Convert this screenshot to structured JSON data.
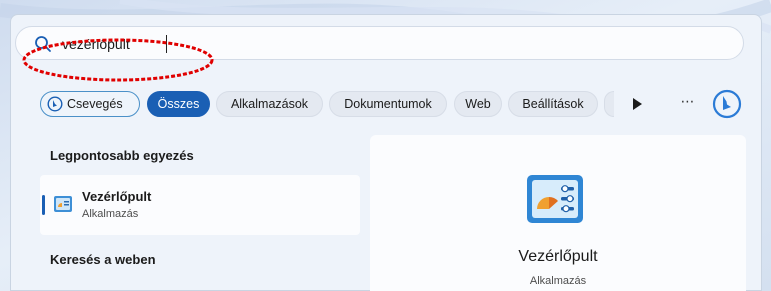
{
  "search": {
    "value": "vezérlőpult",
    "icon": "search-icon"
  },
  "filters": {
    "chat_label": "Csevegés",
    "items": [
      "Összes",
      "Alkalmazások",
      "Dokumentumok",
      "Web",
      "Beállítások"
    ],
    "active": "Összes",
    "more_icon": "play-arrow-icon",
    "overflow_icon": "ellipsis-icon",
    "bing_icon": "bing-icon"
  },
  "results": {
    "best_match_title": "Legpontosabb egyezés",
    "best_match": {
      "name": "Vezérlőpult",
      "type": "Alkalmazás",
      "icon": "control-panel-icon"
    },
    "web_title": "Keresés a weben"
  },
  "detail": {
    "name": "Vezérlőpult",
    "type": "Alkalmazás",
    "icon": "control-panel-icon"
  },
  "colors": {
    "accent": "#1a5fb4",
    "annotation": "#e00000",
    "panel": "#eef3fa"
  }
}
